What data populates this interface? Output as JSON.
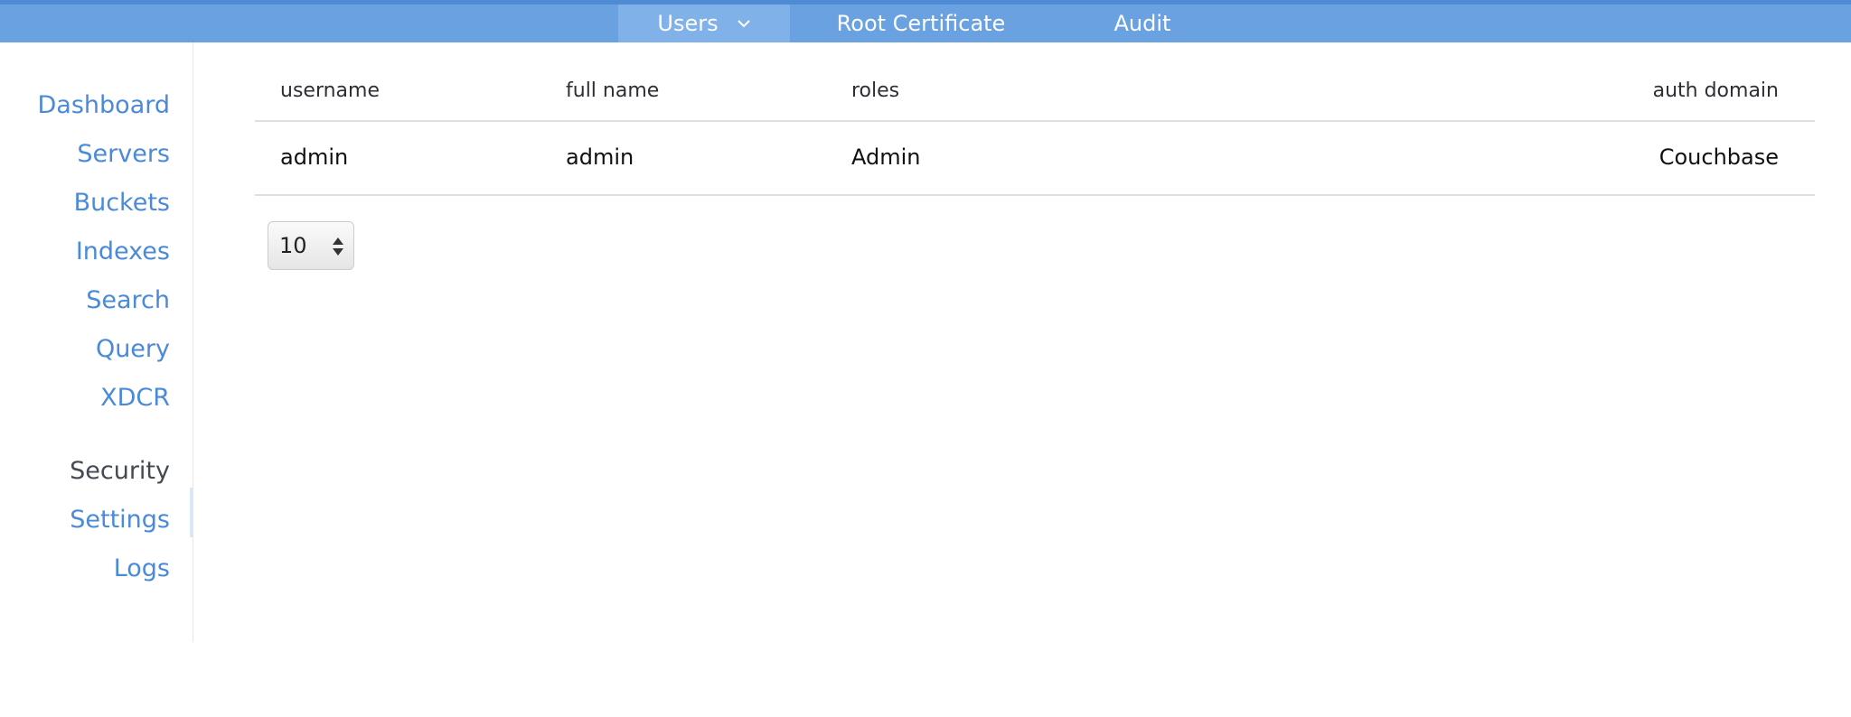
{
  "topnav": {
    "tabs": [
      {
        "label": "Users",
        "active": true,
        "has_dropdown": true
      },
      {
        "label": "Root Certificate",
        "active": false
      },
      {
        "label": "Audit",
        "active": false
      }
    ]
  },
  "sidebar": {
    "items": [
      {
        "label": "Dashboard",
        "active": false
      },
      {
        "label": "Servers",
        "active": false
      },
      {
        "label": "Buckets",
        "active": false
      },
      {
        "label": "Indexes",
        "active": false
      },
      {
        "label": "Search",
        "active": false
      },
      {
        "label": "Query",
        "active": false
      },
      {
        "label": "XDCR",
        "active": false
      },
      {
        "label": "Security",
        "active": true
      },
      {
        "label": "Settings",
        "active": false
      },
      {
        "label": "Logs",
        "active": false
      }
    ]
  },
  "users_table": {
    "columns": [
      "username",
      "full name",
      "roles",
      "auth domain"
    ],
    "rows": [
      {
        "username": "admin",
        "full_name": "admin",
        "roles": "Admin",
        "auth_domain": "Couchbase"
      }
    ]
  },
  "pagination": {
    "page_size": "10"
  },
  "colors": {
    "nav_bar": "#6aa1e0",
    "nav_active_tab": "#80b1e8",
    "link": "#4a8ad8",
    "active_text": "#444a52"
  }
}
